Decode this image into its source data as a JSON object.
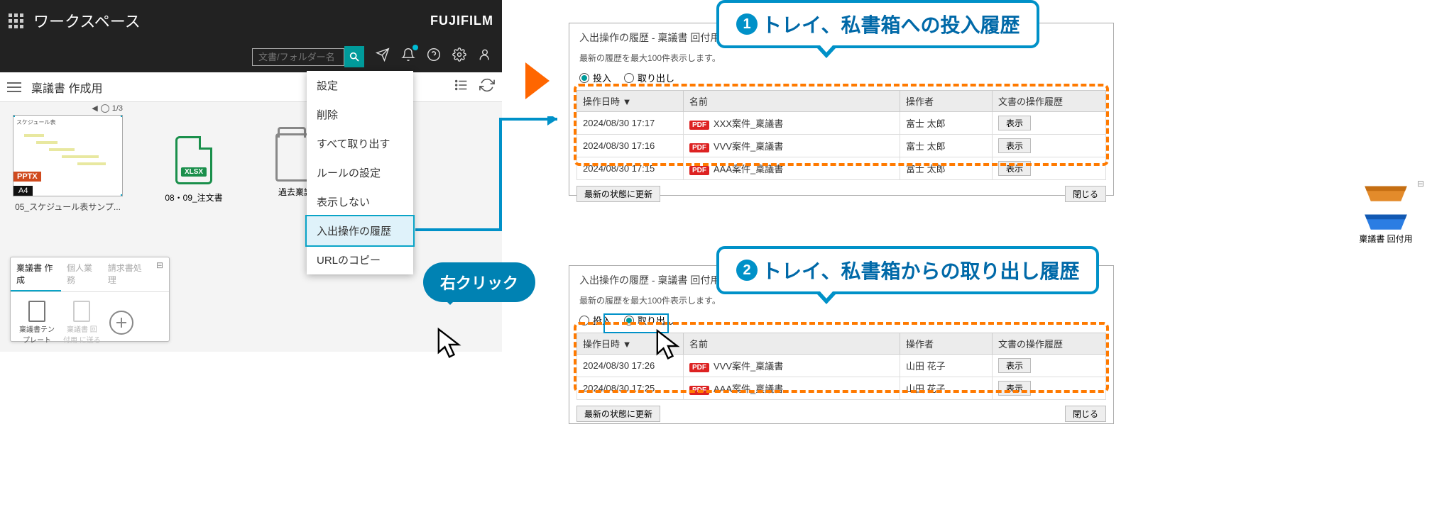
{
  "ws": {
    "title": "ワークスペース",
    "logo": "FUJIFILM",
    "search_placeholder": "文書/フォルダー名",
    "breadcrumb": "稟議書 作成用",
    "files": {
      "pptx_label": "05_スケジュール表サンプ...",
      "pptx_badge": "PPTX",
      "a4_badge": "A4",
      "pptx_thumb_title": "スケジュール表",
      "pager": "1/3",
      "xlsx_badge": "XLSX",
      "xlsx_label": "08・09_注文書",
      "folder_label": "過去稟議デー..."
    }
  },
  "tabs": {
    "t1": "稟議書 作成",
    "t2": "個人業務",
    "t3": "請求書処理",
    "item1a": "稟議書テン",
    "item1b": "プレート",
    "item2a": "稟議書 回",
    "item2b": "付用 に送る"
  },
  "context_menu": {
    "i0": "設定",
    "i1": "削除",
    "i2": "すべて取り出す",
    "i3": "ルールの設定",
    "i4": "表示しない",
    "i5": "入出操作の履歴",
    "i6": "URLのコピー"
  },
  "trays": {
    "circulate": "稟議書 回付用"
  },
  "bubble": "右クリック",
  "callout1": "トレイ、私書箱への投入履歴",
  "callout2": "トレイ、私書箱からの取り出し履歴",
  "dialog_common": {
    "title": "入出操作の履歴 - 稟議書 回付用",
    "hint": "最新の履歴を最大100件表示します。",
    "radio_in": "投入",
    "radio_out": "取り出し",
    "col_date": "操作日時 ▼",
    "col_name": "名前",
    "col_user": "操作者",
    "col_hist": "文書の操作履歴",
    "refresh": "最新の状態に更新",
    "close": "閉じる",
    "show": "表示"
  },
  "dialog1_rows": [
    {
      "date": "2024/08/30 17:17",
      "name": "XXX案件_稟議書",
      "user": "富士 太郎"
    },
    {
      "date": "2024/08/30 17:16",
      "name": "VVV案件_稟議書",
      "user": "富士 太郎"
    },
    {
      "date": "2024/08/30 17:15",
      "name": "AAA案件_稟議書",
      "user": "富士 太郎"
    }
  ],
  "dialog2_rows": [
    {
      "date": "2024/08/30 17:26",
      "name": "VVV案件_稟議書",
      "user": "山田 花子"
    },
    {
      "date": "2024/08/30 17:25",
      "name": "AAA案件_稟議書",
      "user": "山田 花子"
    }
  ]
}
